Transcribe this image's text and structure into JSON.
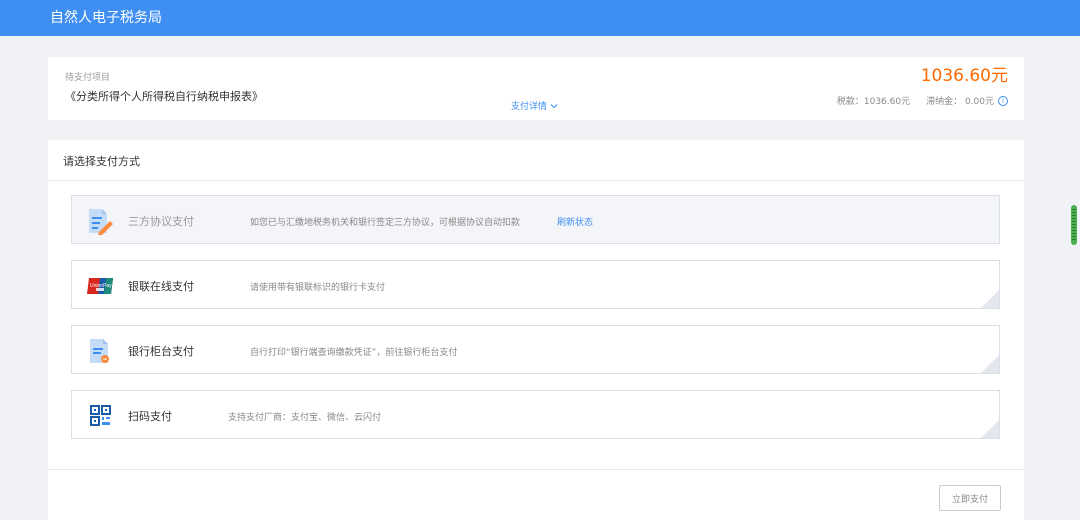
{
  "app": {
    "title": "自然人电子税务局"
  },
  "summary": {
    "pending_label": "待支付项目",
    "item_name": "《分类所得个人所得税自行纳税申报表》",
    "detail_link": "支付详情",
    "amount": "1036.60元",
    "tax_label": "税款：1036.60元",
    "late_fee_label": "滞纳金： 0.00元"
  },
  "payment": {
    "section_title": "请选择支付方式",
    "options": [
      {
        "name": "三方协议支付",
        "desc": "如您已与汇缴地税务机关和银行签定三方协议，可根据协议自动扣款",
        "link": "刷新状态",
        "icon": "agreement-icon",
        "disabled": true
      },
      {
        "name": "银联在线支付",
        "desc": "请使用带有银联标识的银行卡支付",
        "icon": "unionpay-icon"
      },
      {
        "name": "银行柜台支付",
        "desc": "自行打印“银行端查询缴款凭证”，前往银行柜台支付",
        "icon": "bank-voucher-icon"
      },
      {
        "name": "扫码支付",
        "desc": "支持支付厂商：支付宝、微信、云闪付",
        "icon": "qr-code-icon"
      }
    ],
    "pay_button": "立即支付"
  },
  "colors": {
    "brand": "#3f8ff2",
    "amount": "#ff6a00",
    "unionpay_red": "#d7261d"
  }
}
